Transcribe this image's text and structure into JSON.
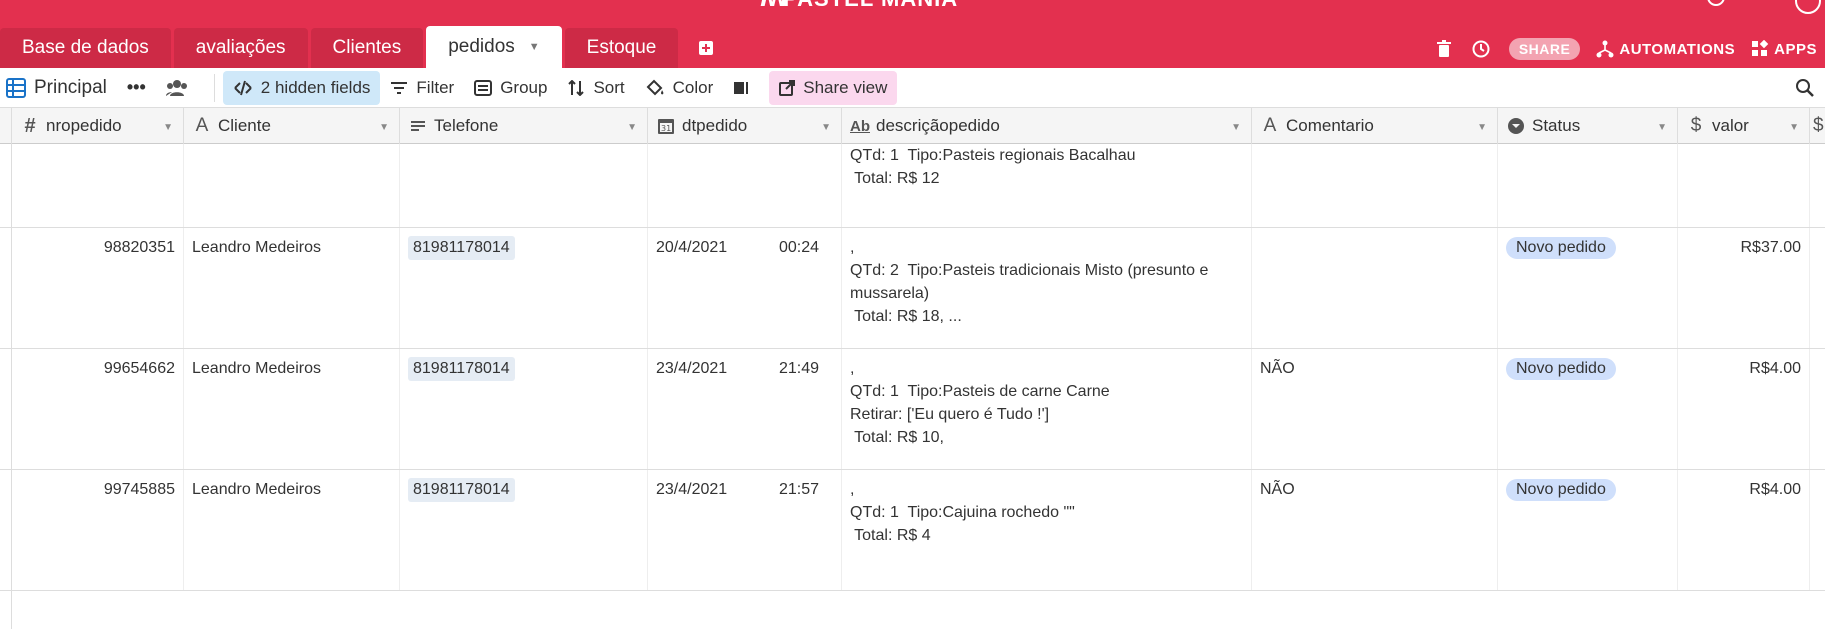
{
  "app": {
    "title": "PASTEL MANIA"
  },
  "tabs": [
    {
      "label": "Base de dados",
      "active": false
    },
    {
      "label": "avaliações",
      "active": false
    },
    {
      "label": "Clientes",
      "active": false
    },
    {
      "label": "pedidos",
      "active": true
    },
    {
      "label": "Estoque",
      "active": false
    }
  ],
  "top_actions": {
    "share": "SHARE",
    "automations": "AUTOMATIONS",
    "apps": "APPS"
  },
  "viewbar": {
    "view_name": "Principal",
    "hidden_fields": "2 hidden fields",
    "filter": "Filter",
    "group": "Group",
    "sort": "Sort",
    "color": "Color",
    "share_view": "Share view"
  },
  "columns": [
    {
      "label": "nropedido",
      "icon": "number-icon"
    },
    {
      "label": "Cliente",
      "icon": "text-icon"
    },
    {
      "label": "Telefone",
      "icon": "phone-icon"
    },
    {
      "label": "dtpedido",
      "icon": "date-icon"
    },
    {
      "label": "descriçãopedido",
      "icon": "longtext-icon"
    },
    {
      "label": "Comentario",
      "icon": "text-icon"
    },
    {
      "label": "Status",
      "icon": "select-icon"
    },
    {
      "label": "valor",
      "icon": "currency-icon"
    }
  ],
  "rows": [
    {
      "nropedido": "",
      "cliente": "",
      "telefone": "",
      "data": "",
      "hora": "",
      "desc": [
        "QTd: 1  Tipo:Pasteis regionais Bacalhau",
        " Total: R$ 12"
      ],
      "comentario": "",
      "status": "",
      "valor": ""
    },
    {
      "nropedido": "98820351",
      "cliente": "Leandro Medeiros",
      "telefone": "81981178014",
      "data": "20/4/2021",
      "hora": "00:24",
      "desc": [
        ",",
        "QTd: 2  Tipo:Pasteis tradicionais Misto (presunto e",
        "mussarela)",
        " Total: R$ 18, ..."
      ],
      "comentario": "",
      "status": "Novo pedido",
      "valor": "R$37.00"
    },
    {
      "nropedido": "99654662",
      "cliente": "Leandro Medeiros",
      "telefone": "81981178014",
      "data": "23/4/2021",
      "hora": "21:49",
      "desc": [
        ",",
        "QTd: 1  Tipo:Pasteis de carne Carne",
        "Retirar: ['Eu quero é Tudo !']",
        " Total: R$ 10,"
      ],
      "comentario": "NÃO",
      "status": "Novo pedido",
      "valor": "R$4.00"
    },
    {
      "nropedido": "99745885",
      "cliente": "Leandro Medeiros",
      "telefone": "81981178014",
      "data": "23/4/2021",
      "hora": "21:57",
      "desc": [
        ",",
        "QTd: 1  Tipo:Cajuina rochedo \"\"",
        " Total: R$ 4"
      ],
      "comentario": "NÃO",
      "status": "Novo pedido",
      "valor": "R$4.00"
    }
  ],
  "colors": {
    "brand": "#e3304f",
    "tab_inactive": "#cd2a46",
    "hidden_fields_bg": "#cfe8f9",
    "share_view_bg": "#fbd8ee",
    "status_pill": "#cfdffb"
  }
}
